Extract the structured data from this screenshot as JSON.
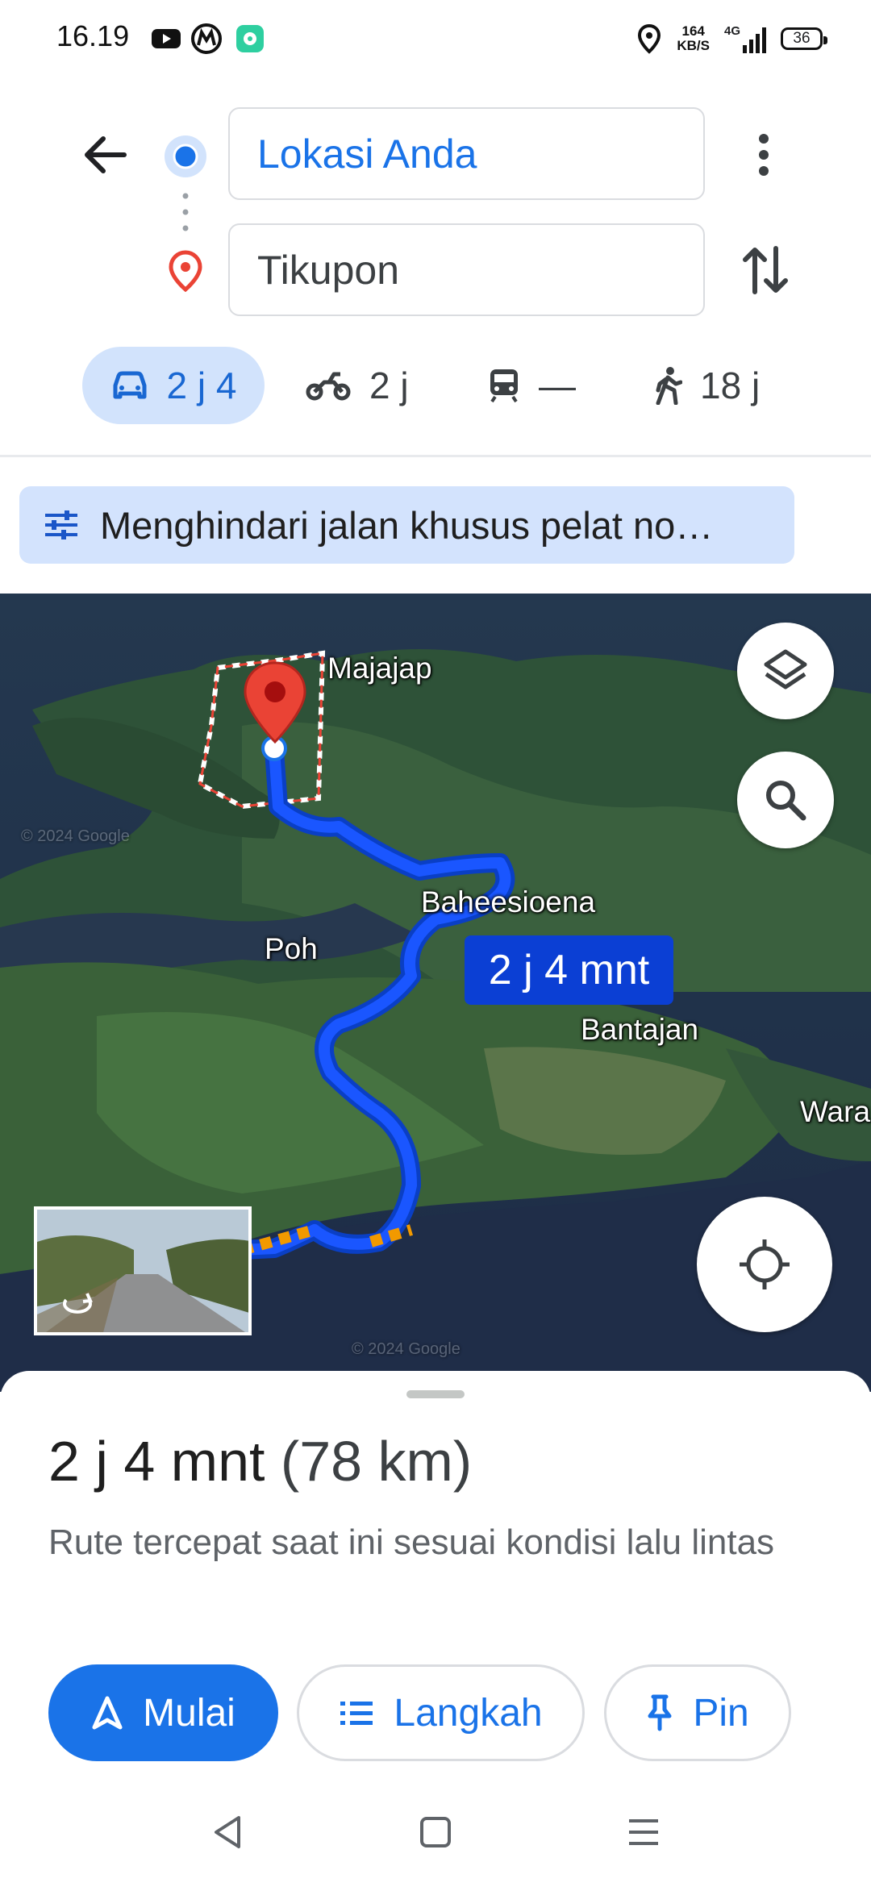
{
  "status_bar": {
    "time": "16.19",
    "net_speed_value": "164",
    "net_speed_unit": "KB/S",
    "network_type": "4G",
    "battery": "36"
  },
  "directions": {
    "origin": "Lokasi Anda",
    "destination": "Tikupon"
  },
  "modes": {
    "car": "2 j 4",
    "motorcycle": "2 j",
    "transit": "—",
    "walk": "18 j"
  },
  "avoid_chip": "Menghindari jalan khusus pelat no…",
  "map": {
    "labels": {
      "majajap": "Majajap",
      "baheesioena": "Baheesioena",
      "poh": "Poh",
      "bantajan": "Bantajan",
      "wara": "Wara"
    },
    "route_badge": "2 j 4 mnt",
    "watermark": "© 2024 Google"
  },
  "summary": {
    "duration": "2 j 4 mnt",
    "distance": "(78 km)",
    "description": "Rute tercepat saat ini sesuai kondisi lalu lintas"
  },
  "actions": {
    "start": "Mulai",
    "steps": "Langkah",
    "pin": "Pin"
  },
  "colors": {
    "accent": "#1a73e8",
    "route": "#1a56ff",
    "destination_pin": "#ea4335"
  }
}
